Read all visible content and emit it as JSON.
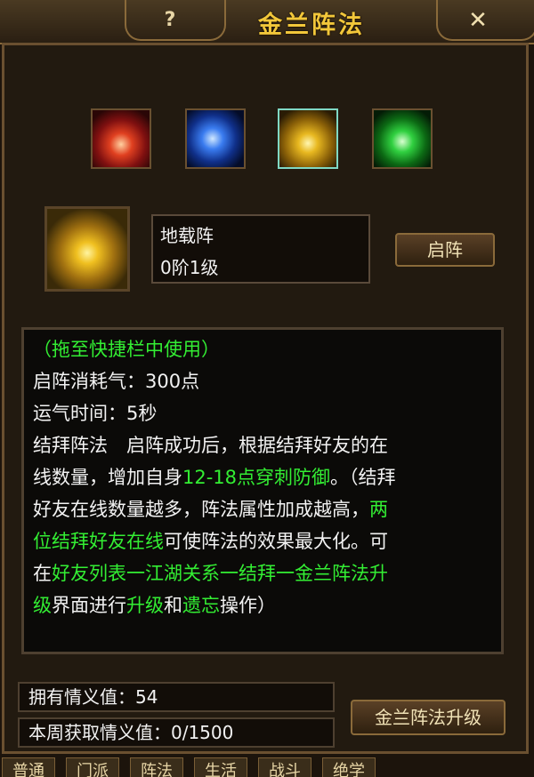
{
  "window": {
    "title": "金兰阵法",
    "help_label": "?",
    "close_label": "✕"
  },
  "skills": [
    {
      "icon": "red-formation-icon",
      "color": "#d83020"
    },
    {
      "icon": "blue-formation-icon",
      "color": "#2a6cf0"
    },
    {
      "icon": "gold-formation-icon",
      "color": "#e8b820",
      "selected": true
    },
    {
      "icon": "green-formation-icon",
      "color": "#28c838"
    }
  ],
  "selected": {
    "name": "地载阵",
    "level": "0阶1级",
    "activate_label": "启阵"
  },
  "description": {
    "line1": "（拖至快捷栏中使用）",
    "line2": "启阵消耗气：300点",
    "line3": "运气时间：5秒",
    "line4": "结拜阵法　启阵成功后，根据结拜好友的在",
    "line5a": "线数量，增加自身",
    "line5b": "12-18点穿刺防御",
    "line5c": "。（结拜",
    "line6a": "好友在线数量越多，阵法属性加成越高，",
    "line6b": "两",
    "line7a": "位结拜好友在线",
    "line7b": "可使阵法的效果最大化。可",
    "line8a": "在",
    "line8b": "好友列表一江湖关系一结拜一金兰阵法升",
    "line9a": "级",
    "line9b": "界面进行",
    "line9c": "升级",
    "line9d": "和",
    "line9e": "遗忘",
    "line9f": "操作）"
  },
  "stats": {
    "owned": "拥有情义值：54",
    "weekly": "本周获取情义值：0/1500"
  },
  "upgrade_label": "金兰阵法升级",
  "tabs": [
    "普通",
    "门派",
    "阵法",
    "生活",
    "战斗",
    "绝学"
  ],
  "colors": {
    "title_gold": "#f2c73a",
    "highlight_green": "#33ee33"
  }
}
